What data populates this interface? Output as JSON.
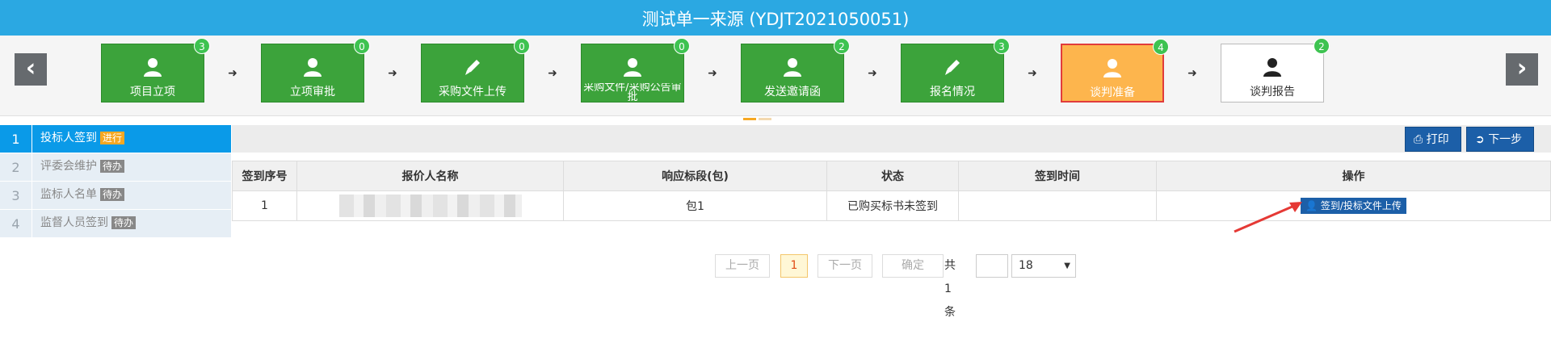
{
  "title": "测试单一来源 (YDJT2021050051)",
  "steps": [
    {
      "label": "项目立项",
      "badge": "3",
      "icon": "user-icon"
    },
    {
      "label": "立项审批",
      "badge": "0",
      "icon": "user-icon"
    },
    {
      "label": "采购文件上传",
      "badge": "0",
      "icon": "pencil-icon"
    },
    {
      "label": "采购文件/采购公告审批",
      "badge": "0",
      "icon": "user-icon"
    },
    {
      "label": "发送邀请函",
      "badge": "2",
      "icon": "user-icon"
    },
    {
      "label": "报名情况",
      "badge": "3",
      "icon": "pencil-icon"
    },
    {
      "label": "谈判准备",
      "badge": "4",
      "icon": "user-icon"
    },
    {
      "label": "谈判报告",
      "badge": "2",
      "icon": "user-icon"
    }
  ],
  "nav": {
    "prev": "‹",
    "next": "›"
  },
  "sidebar": [
    {
      "num": "1",
      "label": "投标人签到",
      "tag": "进行"
    },
    {
      "num": "2",
      "label": "评委会维护",
      "tag": "待办"
    },
    {
      "num": "3",
      "label": "监标人名单",
      "tag": "待办"
    },
    {
      "num": "4",
      "label": "监督人员签到",
      "tag": "待办"
    }
  ],
  "toolbar": {
    "print": "打印",
    "next": "下一步"
  },
  "table": {
    "headers": [
      "签到序号",
      "报价人名称",
      "响应标段(包)",
      "状态",
      "签到时间",
      "操作"
    ],
    "rows": [
      {
        "seq": "1",
        "name": "",
        "section": "包1",
        "status": "已购买标书未签到",
        "time": "",
        "action": "签到/投标文件上传"
      }
    ]
  },
  "pager": {
    "prev": "上一页",
    "current": "1",
    "next": "下一页",
    "confirm": "确定",
    "total": "共1条",
    "page_size": "18"
  },
  "colors": {
    "titlebar": "#2ba8e2",
    "step_done": "#3ca33b",
    "step_active": "#fdb54d",
    "primary_button": "#1c5fa8",
    "annotation_arrow": "#e53935"
  }
}
